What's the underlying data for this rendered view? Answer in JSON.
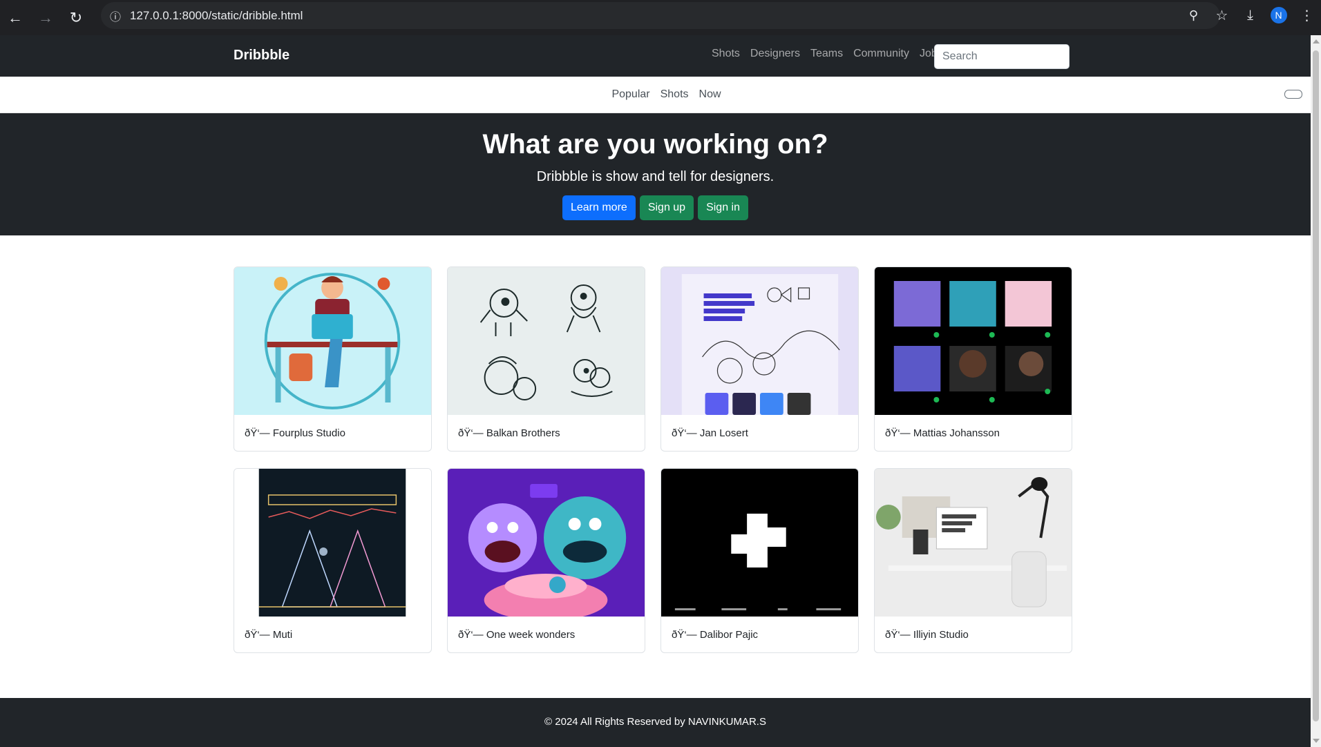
{
  "browser": {
    "url": "127.0.0.1:8000/static/dribble.html",
    "profile_initial": "N"
  },
  "navbar": {
    "brand": "Dribbble",
    "links": [
      "Shots",
      "Designers",
      "Teams",
      "Community",
      "Jobs"
    ],
    "search_placeholder": "Search"
  },
  "subnav": {
    "links": [
      "Popular",
      "Shots",
      "Now"
    ]
  },
  "hero": {
    "title": "What are you working on?",
    "subtitle": "Dribbble is show and tell for designers.",
    "buttons": [
      "Learn more",
      "Sign up",
      "Sign in"
    ]
  },
  "shots": [
    {
      "label": "ðŸ‘— Fourplus Studio",
      "image": "cartoon-man-at-desk"
    },
    {
      "label": "ðŸ‘— Balkan Brothers",
      "image": "ink-character-sketches"
    },
    {
      "label": "ðŸ‘— Jan Losert",
      "image": "meta-agency-landing"
    },
    {
      "label": "ðŸ‘— Mattias Johansson",
      "image": "music-app-cards"
    },
    {
      "label": "ðŸ‘— Muti",
      "image": "neon-mountain-art"
    },
    {
      "label": "ðŸ‘— One week wonders",
      "image": "monster-cake-illustration"
    },
    {
      "label": "ðŸ‘— Dalibor Pajic",
      "image": "white-cross-logo"
    },
    {
      "label": "ðŸ‘— Illiyin Studio",
      "image": "studio-desk-photo"
    }
  ],
  "footer": {
    "text": "© 2024 All Rights Reserved by NAVINKUMAR.S"
  }
}
